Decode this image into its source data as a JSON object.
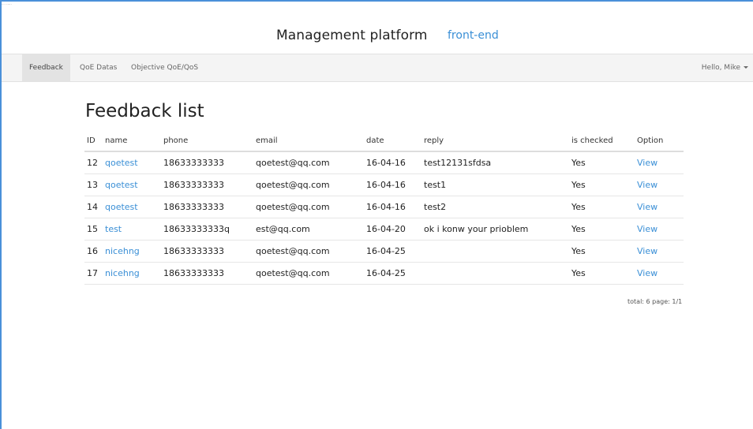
{
  "header": {
    "title": "Management platform",
    "subtitle": "front-end",
    "corner": "... ......"
  },
  "nav": {
    "items": [
      {
        "label": "Feedback",
        "active": true
      },
      {
        "label": "QoE Datas",
        "active": false
      },
      {
        "label": "Objective QoE/QoS",
        "active": false
      }
    ],
    "user": "Hello, Mike"
  },
  "main": {
    "title": "Feedback list",
    "columns": [
      "ID",
      "name",
      "phone",
      "email",
      "date",
      "reply",
      "is checked",
      "Option"
    ],
    "rows": [
      {
        "id": "12",
        "name": "qoetest",
        "phone": "18633333333",
        "email": "qoetest@qq.com",
        "date": "16-04-16",
        "reply": "test12131sfdsa",
        "checked": "Yes",
        "option": "View"
      },
      {
        "id": "13",
        "name": "qoetest",
        "phone": "18633333333",
        "email": "qoetest@qq.com",
        "date": "16-04-16",
        "reply": "test1",
        "checked": "Yes",
        "option": "View"
      },
      {
        "id": "14",
        "name": "qoetest",
        "phone": "18633333333",
        "email": "qoetest@qq.com",
        "date": "16-04-16",
        "reply": "test2",
        "checked": "Yes",
        "option": "View"
      },
      {
        "id": "15",
        "name": "test",
        "phone": "18633333333q",
        "email": "est@qq.com",
        "date": "16-04-20",
        "reply": "ok i konw your prioblem",
        "checked": "Yes",
        "option": "View"
      },
      {
        "id": "16",
        "name": "nicehng",
        "phone": "18633333333",
        "email": "qoetest@qq.com",
        "date": "16-04-25",
        "reply": "",
        "checked": "Yes",
        "option": "View"
      },
      {
        "id": "17",
        "name": "nicehng",
        "phone": "18633333333",
        "email": "qoetest@qq.com",
        "date": "16-04-25",
        "reply": "",
        "checked": "Yes",
        "option": "View"
      }
    ],
    "pager": "total: 6 page: 1/1"
  },
  "colors": {
    "accent": "#3a8fd6",
    "frame": "#4a90d9",
    "navbar": "#f4f4f4"
  }
}
